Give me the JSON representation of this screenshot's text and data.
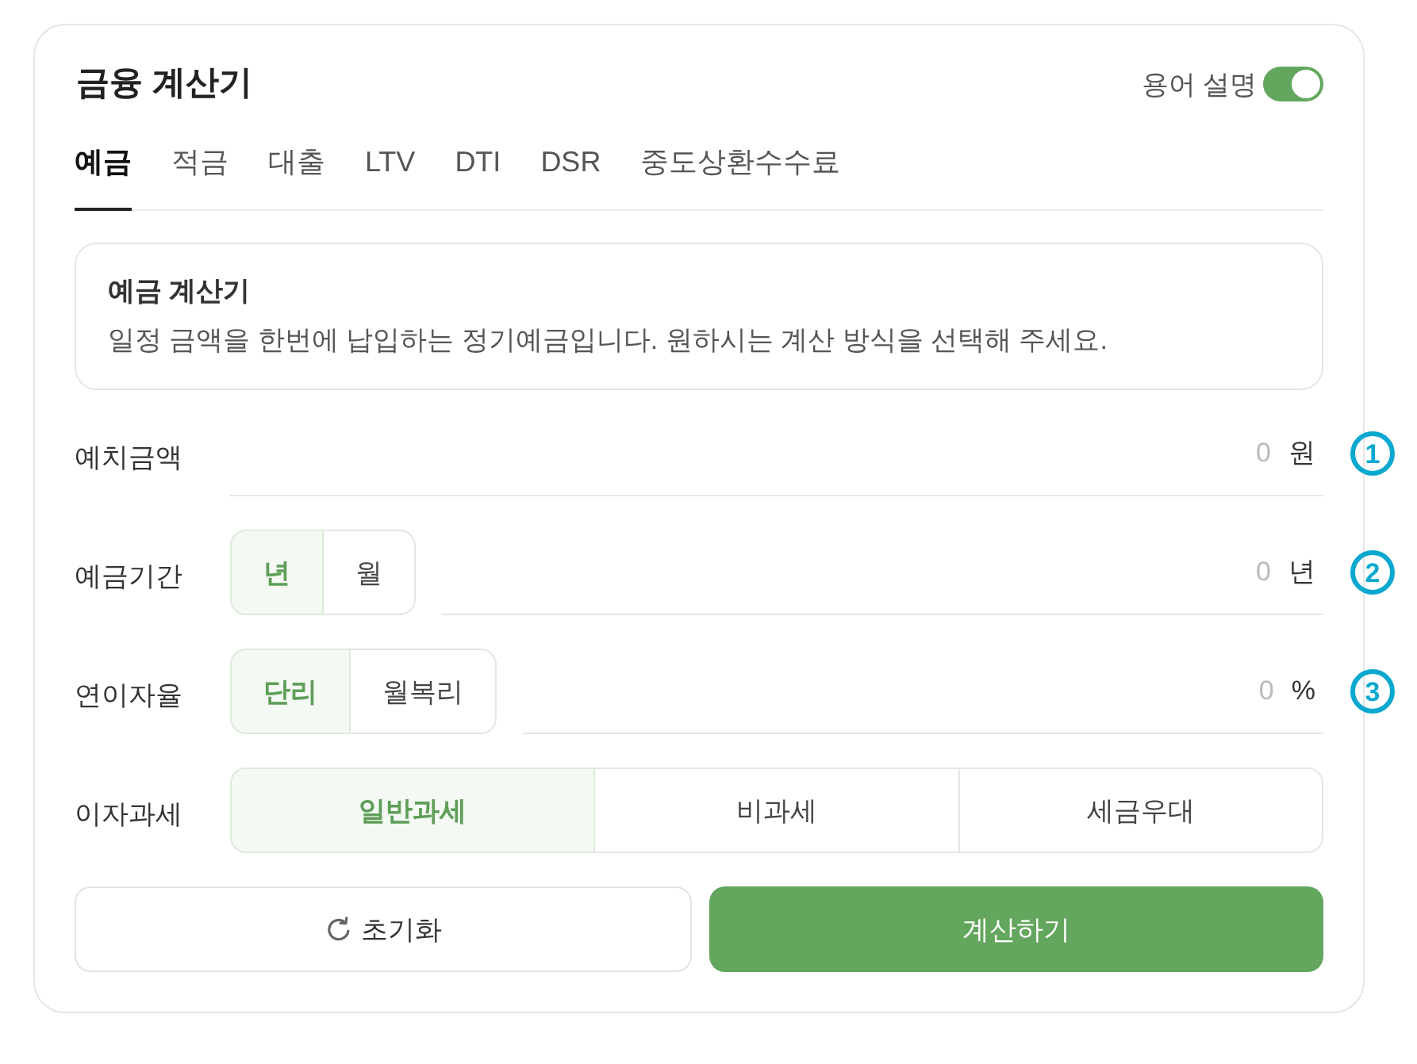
{
  "calculator": {
    "title": "금융 계산기",
    "term_toggle": {
      "label": "용어 설명",
      "on": true
    }
  },
  "tabs": [
    {
      "label": "예금",
      "selected": true
    },
    {
      "label": "적금",
      "selected": false
    },
    {
      "label": "대출",
      "selected": false
    },
    {
      "label": "LTV",
      "selected": false
    },
    {
      "label": "DTI",
      "selected": false
    },
    {
      "label": "DSR",
      "selected": false
    },
    {
      "label": "중도상환수수료",
      "selected": false
    }
  ],
  "info": {
    "title": "예금 계산기",
    "description": "일정 금액을 한번에 납입하는 정기예금입니다. 원하시는 계산 방식을 선택해 주세요."
  },
  "fields": [
    {
      "label": "예치금액",
      "kind": "input",
      "placeholder": "0",
      "unit": "원",
      "annotation": "1"
    },
    {
      "label": "예금기간",
      "kind": "segment_input",
      "options": [
        {
          "label": "년",
          "selected": true
        },
        {
          "label": "월",
          "selected": false
        }
      ],
      "placeholder": "0",
      "unit": "년",
      "annotation": "2"
    },
    {
      "label": "연이자율",
      "kind": "segment_input",
      "options": [
        {
          "label": "단리",
          "selected": true
        },
        {
          "label": "월복리",
          "selected": false
        }
      ],
      "placeholder": "0",
      "unit": "%",
      "annotation": "3"
    },
    {
      "label": "이자과세",
      "kind": "segment",
      "options": [
        {
          "label": "일반과세",
          "selected": true
        },
        {
          "label": "비과세",
          "selected": false
        },
        {
          "label": "세금우대",
          "selected": false
        }
      ]
    }
  ],
  "buttons": [
    {
      "label": "초기화",
      "kind": "reset"
    },
    {
      "label": "계산하기",
      "kind": "primary"
    }
  ]
}
